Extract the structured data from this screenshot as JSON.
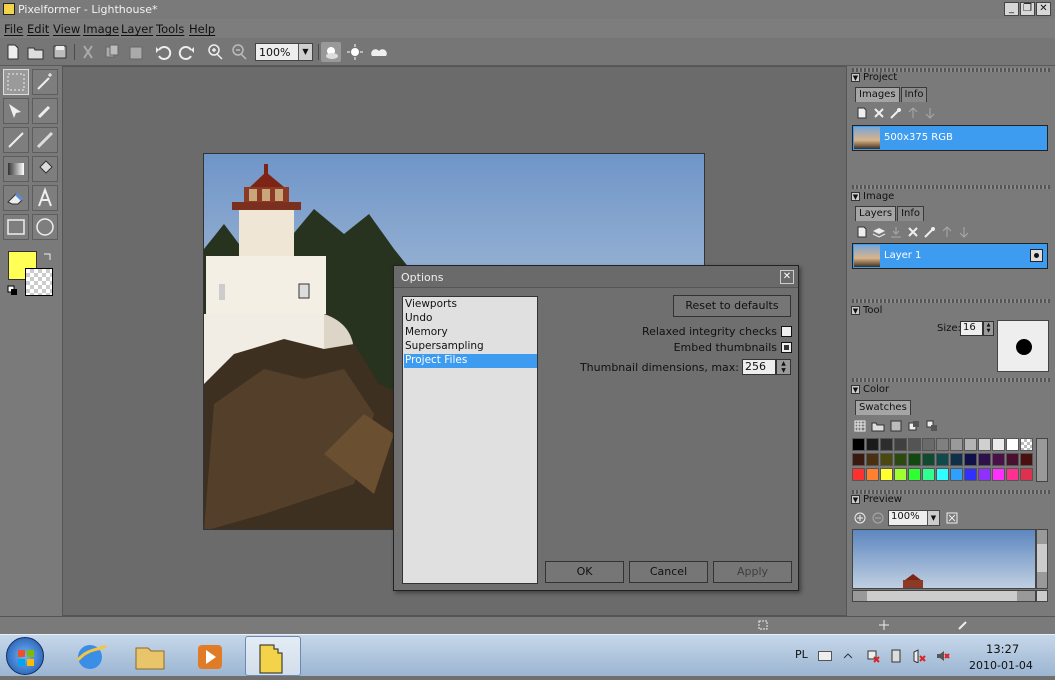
{
  "window": {
    "title": "Pixelformer - Lighthouse*",
    "minimize": "_",
    "restore": "❐",
    "close": "✕"
  },
  "menu": [
    "File",
    "Edit",
    "View",
    "Image",
    "Layer",
    "Tools",
    "Help"
  ],
  "toolbar": {
    "zoom": "100%"
  },
  "panels": {
    "project": {
      "title": "Project",
      "tabs": [
        "Images",
        "Info"
      ],
      "item": "500x375 RGB"
    },
    "image": {
      "title": "Image",
      "tabs": [
        "Layers",
        "Info"
      ],
      "layer": "Layer 1"
    },
    "tool": {
      "title": "Tool",
      "size_label": "Size:",
      "size_value": "16"
    },
    "color": {
      "title": "Color",
      "tabs": [
        "Swatches"
      ]
    },
    "preview": {
      "title": "Preview",
      "zoom": "100%"
    }
  },
  "swatch_colors": [
    "#000000",
    "#1a1a1a",
    "#2d2d2d",
    "#404040",
    "#545454",
    "#6a6a6a",
    "#808080",
    "#9a9a9a",
    "#b4b4b4",
    "#d0d0d0",
    "#ebebeb",
    "#ffffff",
    "checker",
    "#3a1a10",
    "#4a3010",
    "#4a4a10",
    "#2a4a10",
    "#104a10",
    "#104a30",
    "#104a4a",
    "#10304a",
    "#10104a",
    "#30104a",
    "#4a104a",
    "#4a1030",
    "#4a1010",
    "#ff3030",
    "#ff8030",
    "#ffff30",
    "#a0ff30",
    "#30ff30",
    "#30ff90",
    "#30ffff",
    "#30a0ff",
    "#3030ff",
    "#9030ff",
    "#ff30ff",
    "#ff3090",
    "#e03050"
  ],
  "dialog": {
    "title": "Options",
    "close": "✕",
    "categories": [
      "Viewports",
      "Undo",
      "Memory",
      "Supersampling",
      "Project Files"
    ],
    "selected_category": "Project Files",
    "reset": "Reset to defaults",
    "relaxed": "Relaxed integrity checks",
    "embed": "Embed thumbnails",
    "thumb_label": "Thumbnail dimensions, max:",
    "thumb_value": "256",
    "ok": "OK",
    "cancel": "Cancel",
    "apply": "Apply"
  },
  "taskbar": {
    "lang": "PL",
    "time": "13:27",
    "date": "2010-01-04"
  }
}
